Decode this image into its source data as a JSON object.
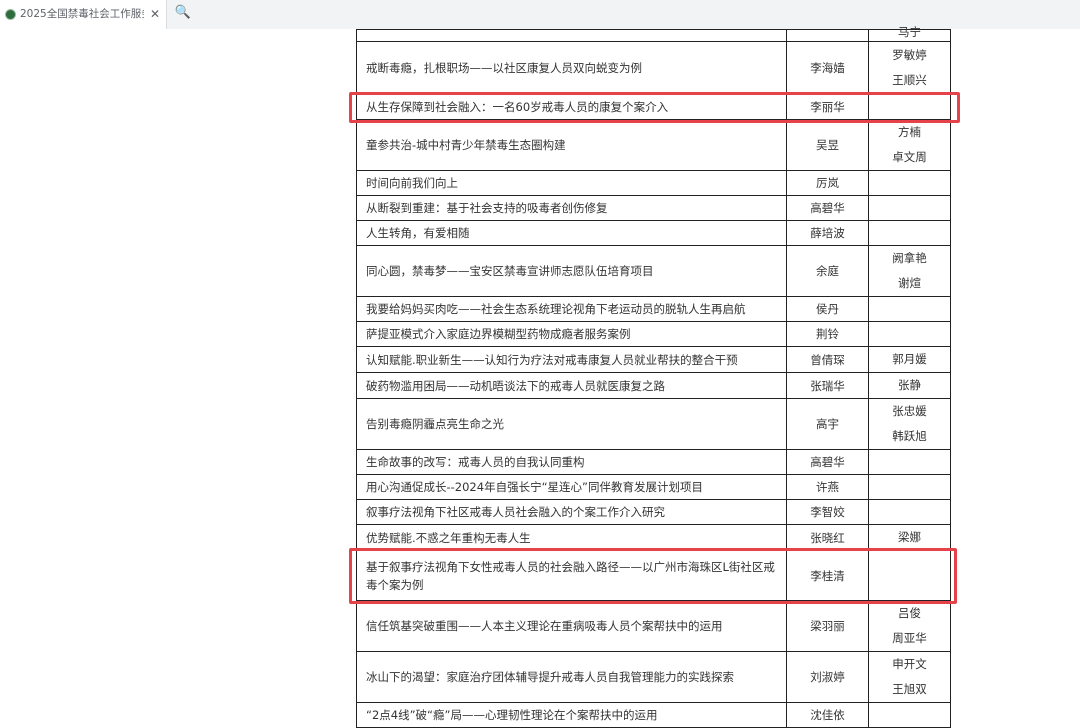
{
  "browser": {
    "tab_title": "2025全国禁毒社会工作服务",
    "close_glyph": "✕",
    "search_glyph": "🔍"
  },
  "colors": {
    "highlight": "#e6424b",
    "tabbar": "#f1f3f4",
    "favicon": "#2e6b3f"
  },
  "table": {
    "rows": [
      {
        "title": "",
        "author": "",
        "partners": [
          "马宁"
        ]
      },
      {
        "title": "戒断毒瘾，扎根职场——以社区康复人员双向蜕变为例",
        "author": "李海嫱",
        "partners": [
          "罗敏婷",
          "王顺兴"
        ]
      },
      {
        "title": "从生存保障到社会融入：一名60岁戒毒人员的康复个案介入",
        "author": "李丽华",
        "partners": [],
        "highlighted": true
      },
      {
        "title": "童参共治-城中村青少年禁毒生态圈构建",
        "author": "吴昱",
        "partners": [
          "方楠",
          "卓文周"
        ]
      },
      {
        "title": "时间向前我们向上",
        "author": "厉岚",
        "partners": []
      },
      {
        "title": "从断裂到重建：基于社会支持的吸毒者创伤修复",
        "author": "高碧华",
        "partners": []
      },
      {
        "title": "人生转角，有爱相随",
        "author": "薛培波",
        "partners": []
      },
      {
        "title": "同心圆，禁毒梦——宝安区禁毒宣讲师志愿队伍培育项目",
        "author": "余庭",
        "partners": [
          "阙拿艳",
          "谢煊"
        ]
      },
      {
        "title": "我要给妈妈买肉吃——社会生态系统理论视角下老运动员的脱轨人生再启航",
        "author": "侯丹",
        "partners": []
      },
      {
        "title": "萨提亚模式介入家庭边界模糊型药物成瘾者服务案例",
        "author": "荆铃",
        "partners": []
      },
      {
        "title": "认知赋能.职业新生——认知行为疗法对戒毒康复人员就业帮扶的整合干预",
        "author": "曾倩琛",
        "partners": [
          "郭月媛"
        ]
      },
      {
        "title": "破药物滥用困局——动机晤谈法下的戒毒人员就医康复之路",
        "author": "张瑞华",
        "partners": [
          "张静"
        ]
      },
      {
        "title": "告别毒瘾阴霾点亮生命之光",
        "author": "高宇",
        "partners": [
          "张忠媛",
          "韩跃旭"
        ]
      },
      {
        "title": "生命故事的改写：戒毒人员的自我认同重构",
        "author": "高碧华",
        "partners": []
      },
      {
        "title": "用心沟通促成长--2024年自强长宁“星连心”同伴教育发展计划项目",
        "author": "许燕",
        "partners": []
      },
      {
        "title": "叙事疗法视角下社区戒毒人员社会融入的个案工作介入研究",
        "author": "李智姣",
        "partners": []
      },
      {
        "title": "优势赋能.不惑之年重构无毒人生",
        "author": "张晓红",
        "partners": [
          "梁娜"
        ]
      },
      {
        "title": "基于叙事疗法视角下女性戒毒人员的社会融入路径——以广州市海珠区L街社区戒毒个案为例",
        "author": "李桂清",
        "partners": [],
        "highlighted": true
      },
      {
        "title": "信任筑基突破重围——人本主义理论在重病吸毒人员个案帮扶中的运用",
        "author": "梁羽丽",
        "partners": [
          "吕俊",
          "周亚华"
        ]
      },
      {
        "title": "冰山下的渴望：家庭治疗团体辅导提升戒毒人员自我管理能力的实践探索",
        "author": "刘淑婷",
        "partners": [
          "申开文",
          "王旭双"
        ]
      },
      {
        "title": "“2点4线”破“瘾”局——心理韧性理论在个案帮扶中的运用",
        "author": "沈佳依",
        "partners": []
      }
    ]
  }
}
